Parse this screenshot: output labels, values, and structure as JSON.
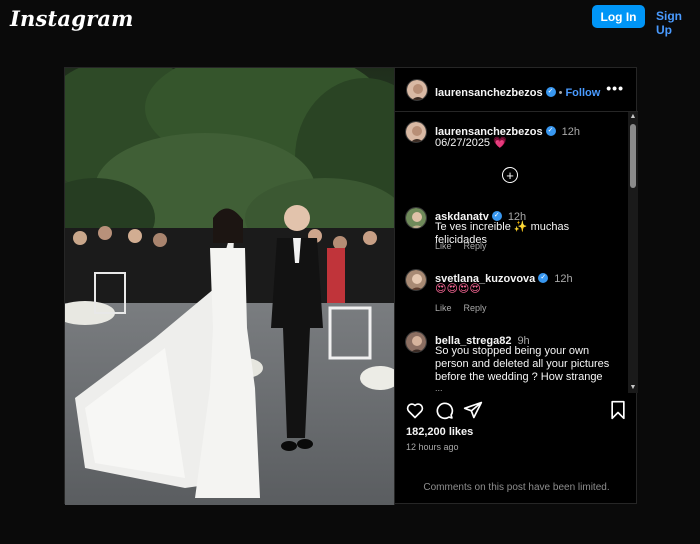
{
  "topbar": {
    "logo": "Instagram",
    "login_label": "Log In",
    "signup_label": "Sign Up"
  },
  "post": {
    "username": "laurensanchezbezos",
    "follow_label": "Follow",
    "separator": "•",
    "more_label": "•••",
    "caption": {
      "time": "12h",
      "text": "06/27/2025",
      "emoji": "💗"
    },
    "add_symbol": "+",
    "comments": [
      {
        "user": "askdanatv",
        "time": "12h",
        "text": "Te ves increible ✨ muchas felicidades",
        "like_label": "Like",
        "reply_label": "Reply",
        "verified": true
      },
      {
        "user": "svetlana_kuzovova",
        "time": "12h",
        "text": "😍😍😍😍",
        "like_label": "Like",
        "reply_label": "Reply",
        "verified": true
      },
      {
        "user": "bella_strega82",
        "time": "9h",
        "text": "So you stopped being your own person and deleted all your pictures before the wedding ? How strange",
        "verified": false,
        "more": "..."
      }
    ],
    "likes": "182,200 likes",
    "posted": "12 hours ago",
    "limited_notice": "Comments on this post have been limited."
  },
  "colors": {
    "accent": "#0095f6",
    "link": "#4a9bff",
    "background": "#0a0a0a",
    "verified": "#3897f0"
  },
  "icons": [
    "heart-icon",
    "comment-icon",
    "share-icon",
    "bookmark-icon",
    "more-icon",
    "add-icon",
    "verified-icon"
  ]
}
